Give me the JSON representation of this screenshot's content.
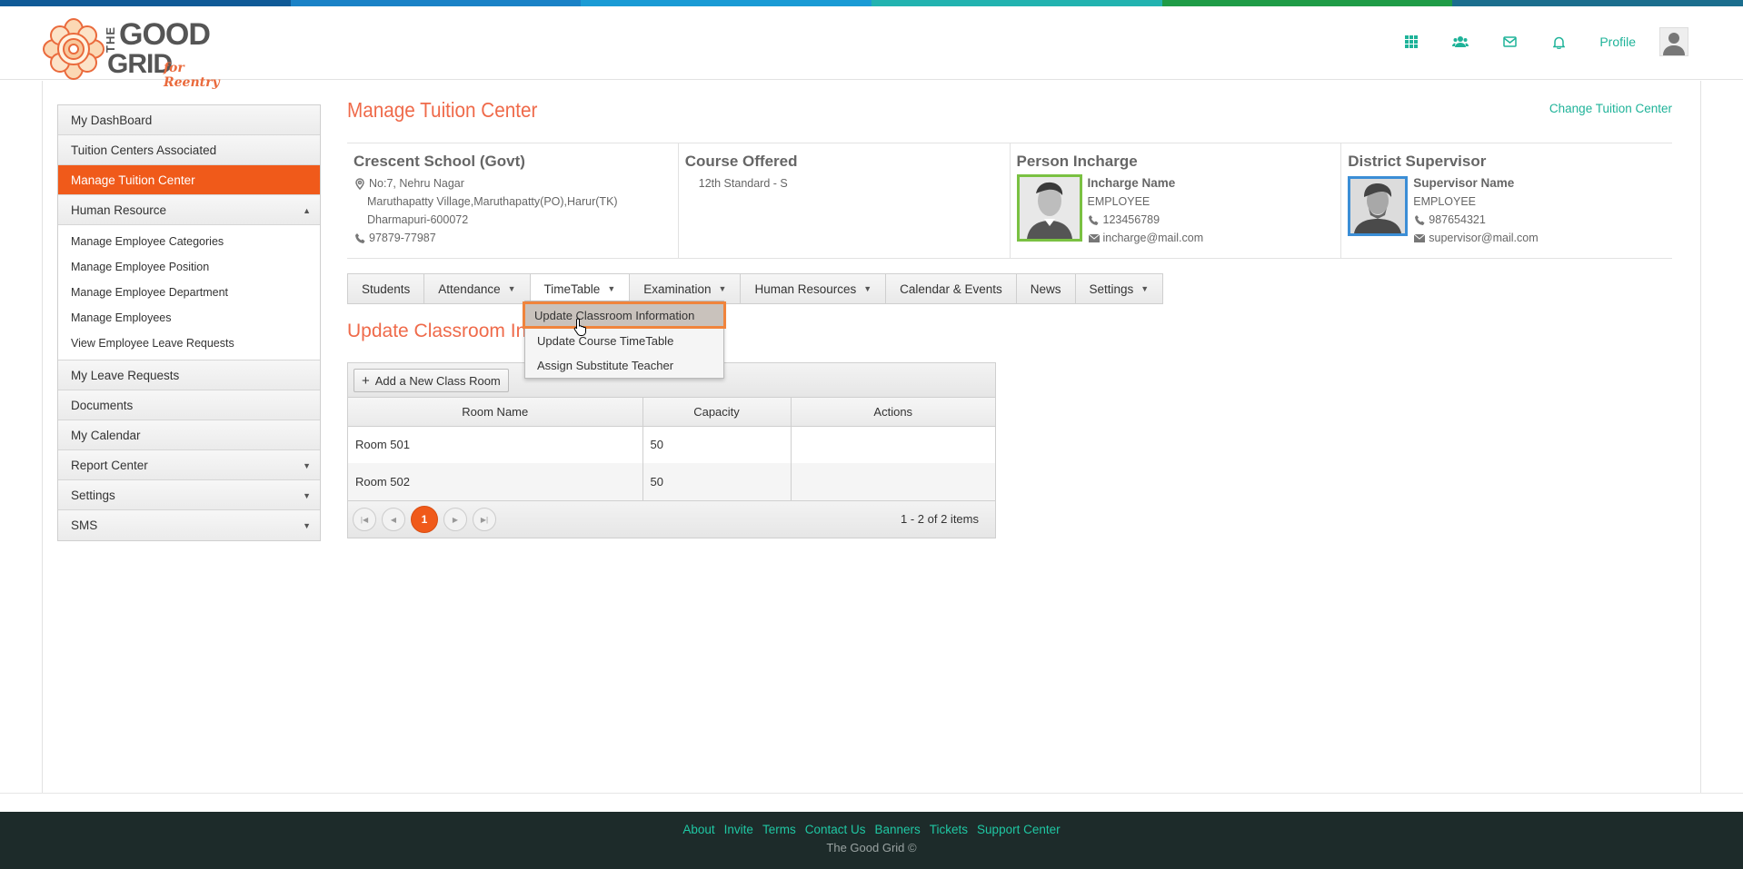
{
  "brand": {
    "the": "THE",
    "good": "GOOD",
    "grid": "GRID",
    "tagline": "for Reentry",
    "colors": {
      "accent_orange": "#f05a1a",
      "teal": "#1fb399",
      "title": "#ef6a4a"
    }
  },
  "topbar_colors": [
    "#0f5a97",
    "#1a82c7",
    "#1a9bd5",
    "#22b3b0",
    "#1f9c47",
    "#1b6e8e"
  ],
  "header": {
    "icons": [
      "apps-grid-icon",
      "people-icon",
      "mail-icon",
      "bell-icon"
    ],
    "profile_label": "Profile"
  },
  "sidebar": {
    "items": [
      {
        "label": "My DashBoard"
      },
      {
        "label": "Tuition Centers Associated"
      },
      {
        "label": "Manage Tuition Center",
        "active": true
      },
      {
        "label": "Human Resource",
        "expanded": true
      }
    ],
    "hr_sub": [
      "Manage Employee Categories",
      "Manage Employee Position",
      "Manage Employee Department",
      "Manage Employees",
      "View Employee Leave Requests"
    ],
    "items_after": [
      {
        "label": "My Leave Requests"
      },
      {
        "label": "Documents"
      },
      {
        "label": "My Calendar"
      },
      {
        "label": "Report Center"
      },
      {
        "label": "Settings"
      },
      {
        "label": "SMS"
      }
    ]
  },
  "page": {
    "title": "Manage Tuition Center",
    "change_link": "Change Tuition Center"
  },
  "info": {
    "school": {
      "name": "Crescent School (Govt)",
      "address1": "No:7, Nehru Nagar",
      "address2": "Maruthapatty Village,Maruthapatty(PO),Harur(TK)",
      "address3": "Dharmapuri-600072",
      "phone": "97879-77987"
    },
    "course": {
      "title": "Course Offered",
      "value": "12th Standard - S"
    },
    "incharge": {
      "title": "Person Incharge",
      "name": "Incharge Name",
      "role": "EMPLOYEE",
      "phone": "123456789",
      "email": "incharge@mail.com"
    },
    "supervisor": {
      "title": "District Supervisor",
      "name": "Supervisor Name",
      "role": "EMPLOYEE",
      "phone": "987654321",
      "email": "supervisor@mail.com"
    }
  },
  "tabs": [
    {
      "label": "Students"
    },
    {
      "label": "Attendance"
    },
    {
      "label": "TimeTable"
    },
    {
      "label": "Examination"
    },
    {
      "label": "Human Resources"
    },
    {
      "label": "Calendar & Events"
    },
    {
      "label": "News"
    },
    {
      "label": "Settings"
    }
  ],
  "timetable_menu": [
    "Update Classroom Information",
    "Update Course TimeTable",
    "Assign Substitute Teacher"
  ],
  "section": {
    "title": "Update Classroom Information"
  },
  "grid": {
    "add_button": "Add a New Class Room",
    "columns": [
      "Room Name",
      "Capacity",
      "Actions"
    ],
    "rows": [
      {
        "name": "Room 501",
        "capacity": "50"
      },
      {
        "name": "Room 502",
        "capacity": "50"
      }
    ],
    "current_page": "1",
    "pager_info": "1 - 2 of 2 items"
  },
  "footer": {
    "links": [
      "About",
      "Invite",
      "Terms",
      "Contact Us",
      "Banners",
      "Tickets",
      "Support Center"
    ],
    "copyright": "The Good Grid ©"
  }
}
